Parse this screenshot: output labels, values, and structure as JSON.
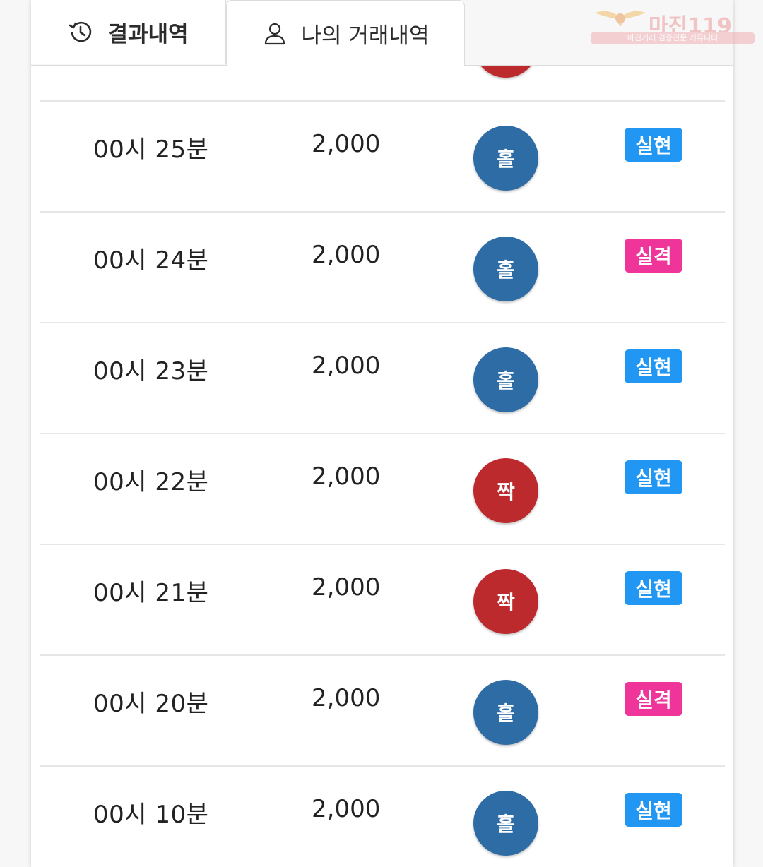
{
  "tabs": [
    {
      "label": "결과내역",
      "icon": "history-icon",
      "active": false
    },
    {
      "label": "나의 거래내역",
      "icon": "user-icon",
      "active": true
    }
  ],
  "watermark": {
    "title": "마진119",
    "subtitle": "마진거래 검증전문 커뮤니티"
  },
  "colors": {
    "odd": "#2e6ca6",
    "even": "#bd2a2e",
    "win": "#2196f3",
    "lose": "#f0359a"
  },
  "rows": [
    {
      "time": "00시 25분",
      "amount": "2,000",
      "pick": "홀",
      "result": "실현"
    },
    {
      "time": "00시 24분",
      "amount": "2,000",
      "pick": "홀",
      "result": "실격"
    },
    {
      "time": "00시 23분",
      "amount": "2,000",
      "pick": "홀",
      "result": "실현"
    },
    {
      "time": "00시 22분",
      "amount": "2,000",
      "pick": "짝",
      "result": "실현"
    },
    {
      "time": "00시 21분",
      "amount": "2,000",
      "pick": "짝",
      "result": "실현"
    },
    {
      "time": "00시 20분",
      "amount": "2,000",
      "pick": "홀",
      "result": "실격"
    },
    {
      "time": "00시 10분",
      "amount": "2,000",
      "pick": "홀",
      "result": "실현"
    }
  ]
}
